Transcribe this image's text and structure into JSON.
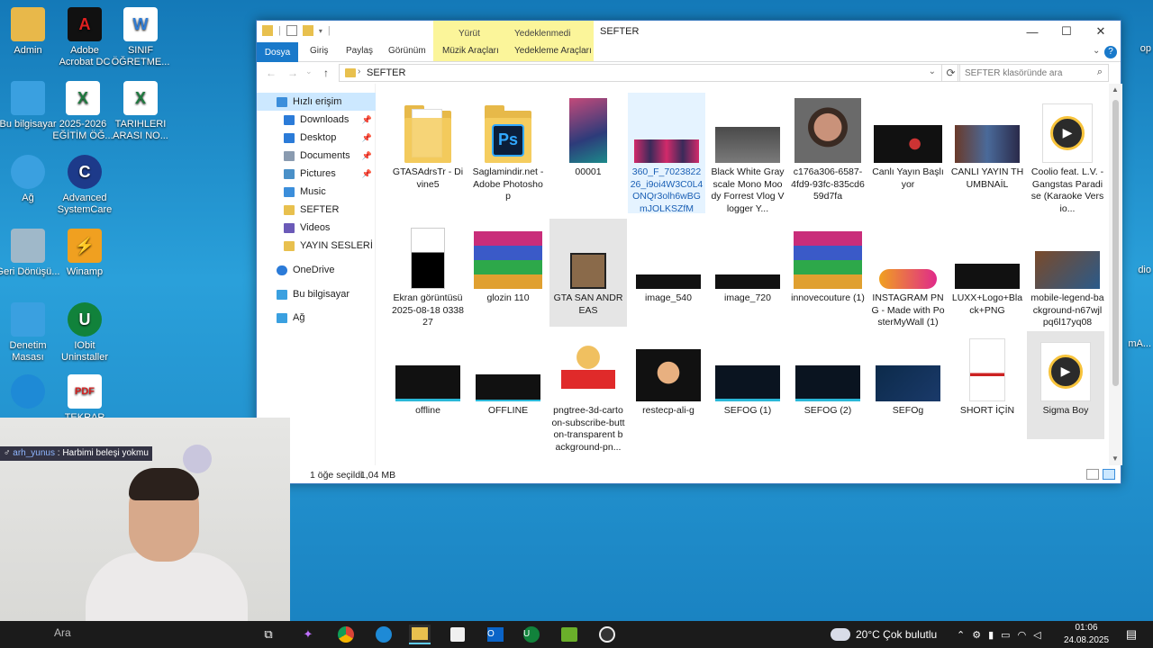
{
  "desktop_icons": [
    {
      "label": "Admin",
      "color": "#e8b84a"
    },
    {
      "label": "Adobe Acrobat DC",
      "color": "#111111"
    },
    {
      "label": "SINIF ÖĞRETME...",
      "color": "#2f7bd4"
    },
    {
      "label": "Bu bilgisayar",
      "color": "#3aa0e0"
    },
    {
      "label": "2025-2026 EĞİTİM ÖĞ...",
      "color": "#1f7a3f"
    },
    {
      "label": "TARIHLERI ARASI NO...",
      "color": "#1f7a3f"
    },
    {
      "label": "Ağ",
      "color": "#3aa0e0"
    },
    {
      "label": "Advanced SystemCare",
      "color": "#1d3a8a"
    },
    {
      "label": "Geri Dönüşü...",
      "color": "#9fb8c9"
    },
    {
      "label": "Winamp",
      "color": "#f0a020"
    },
    {
      "label": "Denetim Masası",
      "color": "#3aa0e0"
    },
    {
      "label": "IObit Uninstaller",
      "color": "#11823b"
    },
    {
      "label": "TEKRAR",
      "color": "#ffffff"
    }
  ],
  "right_strip": [
    "op",
    "dio",
    "mA..."
  ],
  "window": {
    "title": "SEFTER",
    "context_tabs": [
      {
        "group": "Yürüt",
        "tab": "Müzik Araçları"
      },
      {
        "group": "Yedeklenmedi",
        "tab": "Yedekleme Araçları"
      }
    ],
    "ribbon_tabs": [
      "Dosya",
      "Giriş",
      "Paylaş",
      "Görünüm"
    ],
    "help": "?",
    "address": "SEFTER",
    "search_placeholder": "SEFTER klasöründe ara",
    "nav": [
      {
        "label": "Hızlı erişim",
        "pinned": false
      },
      {
        "label": "Downloads",
        "pinned": true
      },
      {
        "label": "Desktop",
        "pinned": true
      },
      {
        "label": "Documents",
        "pinned": true
      },
      {
        "label": "Pictures",
        "pinned": true
      },
      {
        "label": "Music",
        "pinned": false
      },
      {
        "label": "SEFTER",
        "pinned": false
      },
      {
        "label": "Videos",
        "pinned": false
      },
      {
        "label": "YAYIN SESLERİ",
        "pinned": false
      },
      {
        "label": "OneDrive",
        "pinned": false
      },
      {
        "label": "Bu bilgisayar",
        "pinned": false
      },
      {
        "label": "Ağ",
        "pinned": false
      }
    ],
    "files": [
      {
        "name": "GTASAdrsTr - Divine5",
        "kind": "folder"
      },
      {
        "name": "Saglamindir.net - Adobe Photoshop",
        "kind": "folder-ps"
      },
      {
        "name": "00001",
        "kind": "image"
      },
      {
        "name": "360_F_702382226_i9oi4W3C0L4ONQr3olh6wBGmJOLKSZfM",
        "kind": "image"
      },
      {
        "name": "Black White Grayscale Mono Moody Forrest Vlog Vlogger Y...",
        "kind": "image"
      },
      {
        "name": "c176a306-6587-4fd9-93fc-835cd659d7fa",
        "kind": "image"
      },
      {
        "name": "Canlı Yayın Başlıyor",
        "kind": "image"
      },
      {
        "name": "CANLI YAYIN THUMBNAİL",
        "kind": "image"
      },
      {
        "name": "Coolio feat. L.V. - Gangstas Paradise (Karaoke Versio...",
        "kind": "audio"
      },
      {
        "name": "Ekran görüntüsü 2025-08-18 033827",
        "kind": "image"
      },
      {
        "name": "glozin 110",
        "kind": "archive"
      },
      {
        "name": "GTA SAN ANDREAS",
        "kind": "shortcut"
      },
      {
        "name": "image_540",
        "kind": "image"
      },
      {
        "name": "image_720",
        "kind": "image"
      },
      {
        "name": "innovecouture (1)",
        "kind": "archive"
      },
      {
        "name": "INSTAGRAM PNG - Made with PosterMyWall (1)",
        "kind": "image"
      },
      {
        "name": "LUXX+Logo+Black+PNG",
        "kind": "image"
      },
      {
        "name": "mobile-legend-background-n67wjlpq6l17yq08",
        "kind": "image"
      },
      {
        "name": "offline",
        "kind": "image"
      },
      {
        "name": "OFFLINE",
        "kind": "image"
      },
      {
        "name": "pngtree-3d-cartoon-subscribe-button-transparent background-pn...",
        "kind": "image"
      },
      {
        "name": "restecp-ali-g",
        "kind": "image"
      },
      {
        "name": "SEFOG (1)",
        "kind": "image"
      },
      {
        "name": "SEFOG (2)",
        "kind": "image"
      },
      {
        "name": "SEFOg",
        "kind": "image"
      },
      {
        "name": "SHORT İÇİN",
        "kind": "image"
      },
      {
        "name": "Sigma Boy",
        "kind": "audio"
      }
    ],
    "status": {
      "selected": "1 öğe seçildi",
      "size": "1,04 MB"
    }
  },
  "webcam": {
    "chat_prefix": "♂",
    "chat_user": "arh_yunus",
    "chat_message": "Harbimi beleşi yokmu"
  },
  "taskbar": {
    "search_text": "Ara",
    "apps": [
      "copilot",
      "chrome",
      "edge",
      "file-explorer",
      "store",
      "outlook",
      "iobit",
      "android-app",
      "obs"
    ],
    "weather": "20°C  Çok bulutlu",
    "time": "01:06",
    "date": "24.08.2025"
  },
  "colors": {
    "accent": "#1979ca",
    "selection": "#cce8ff",
    "context_tab": "#fbf59a"
  }
}
